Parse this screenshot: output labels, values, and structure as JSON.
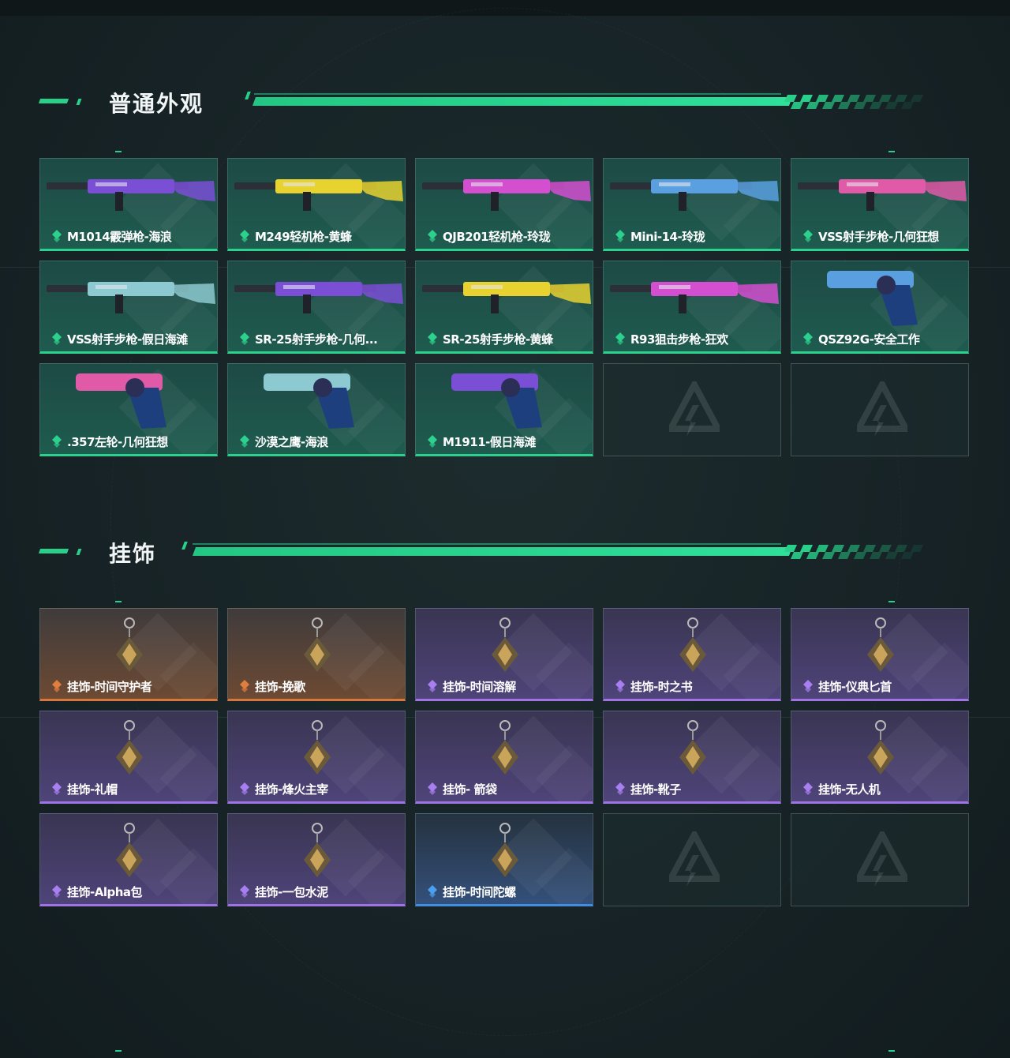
{
  "sections": [
    {
      "title": "普通外观",
      "items": [
        {
          "label": "M1014霰弹枪-海浪",
          "rarity": "green",
          "icon": "shotgun-icon"
        },
        {
          "label": "M249轻机枪-黄蜂",
          "rarity": "green",
          "icon": "machine-gun-icon"
        },
        {
          "label": "QJB201轻机枪-玲珑",
          "rarity": "green",
          "icon": "machine-gun-icon"
        },
        {
          "label": "Mini-14-玲珑",
          "rarity": "green",
          "icon": "rifle-icon"
        },
        {
          "label": "VSS射手步枪-几何狂想",
          "rarity": "green",
          "icon": "rifle-icon"
        },
        {
          "label": "VSS射手步枪-假日海滩",
          "rarity": "green",
          "icon": "rifle-icon"
        },
        {
          "label": "SR-25射手步枪-几何...",
          "rarity": "green",
          "icon": "rifle-icon"
        },
        {
          "label": "SR-25射手步枪-黄蜂",
          "rarity": "green",
          "icon": "rifle-icon"
        },
        {
          "label": "R93狙击步枪-狂欢",
          "rarity": "green",
          "icon": "sniper-icon"
        },
        {
          "label": "QSZ92G-安全工作",
          "rarity": "green",
          "icon": "pistol-icon"
        },
        {
          "label": ".357左轮-几何狂想",
          "rarity": "green",
          "icon": "revolver-icon"
        },
        {
          "label": "沙漠之鹰-海浪",
          "rarity": "green",
          "icon": "pistol-icon"
        },
        {
          "label": "M1911-假日海滩",
          "rarity": "green",
          "icon": "pistol-icon"
        },
        {
          "label": "",
          "rarity": "empty",
          "icon": "empty-slot-logo-icon"
        },
        {
          "label": "",
          "rarity": "empty",
          "icon": "empty-slot-logo-icon"
        }
      ]
    },
    {
      "title": "挂饰",
      "items": [
        {
          "label": "挂饰-时间守护者",
          "rarity": "orange",
          "icon": "charm-icon"
        },
        {
          "label": "挂饰-挽歌",
          "rarity": "orange",
          "icon": "charm-icon"
        },
        {
          "label": "挂饰-时间溶解",
          "rarity": "purple",
          "icon": "charm-icon"
        },
        {
          "label": "挂饰-时之书",
          "rarity": "purple",
          "icon": "charm-icon"
        },
        {
          "label": "挂饰-仪典匕首",
          "rarity": "purple",
          "icon": "charm-icon"
        },
        {
          "label": "挂饰-礼帽",
          "rarity": "purple",
          "icon": "hat-charm-icon"
        },
        {
          "label": "挂饰-烽火主宰",
          "rarity": "purple",
          "icon": "charm-icon"
        },
        {
          "label": "挂饰- 箭袋",
          "rarity": "purple",
          "icon": "charm-icon"
        },
        {
          "label": "挂饰-靴子",
          "rarity": "purple",
          "icon": "boot-charm-icon"
        },
        {
          "label": "挂饰-无人机",
          "rarity": "purple",
          "icon": "drone-charm-icon"
        },
        {
          "label": "挂饰-Alpha包",
          "rarity": "purple",
          "icon": "bag-charm-icon"
        },
        {
          "label": "挂饰-一包水泥",
          "rarity": "purple",
          "icon": "bag-charm-icon"
        },
        {
          "label": "挂饰-时间陀螺",
          "rarity": "blue",
          "icon": "charm-icon"
        },
        {
          "label": "",
          "rarity": "empty",
          "icon": "empty-slot-logo-icon"
        },
        {
          "label": "",
          "rarity": "empty",
          "icon": "empty-slot-logo-icon"
        }
      ]
    }
  ],
  "colors": {
    "green": "#2bd18c",
    "orange": "#d6783e",
    "purple": "#9f73e4",
    "blue": "#3f8fe0",
    "background": "#172326"
  }
}
